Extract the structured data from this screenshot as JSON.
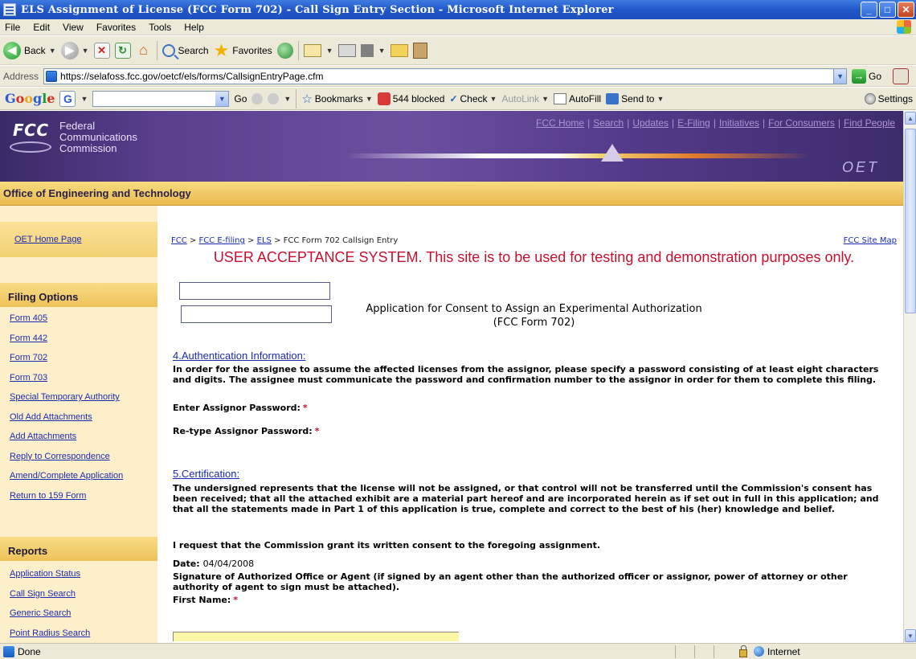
{
  "window": {
    "title": "ELS Assignment of License (FCC Form 702) - Call Sign Entry Section - Microsoft Internet Explorer"
  },
  "menu": [
    "File",
    "Edit",
    "View",
    "Favorites",
    "Tools",
    "Help"
  ],
  "toolbar": {
    "back": "Back",
    "search": "Search",
    "favorites": "Favorites"
  },
  "address": {
    "label": "Address",
    "url": "https://selafoss.fcc.gov/oetcf/els/forms/CallsignEntryPage.cfm",
    "go": "Go"
  },
  "google": {
    "logo": "Google",
    "go": "Go",
    "bookmarks": "Bookmarks",
    "blocked": "544 blocked",
    "check": "Check",
    "autolink": "AutoLink",
    "autofill": "AutoFill",
    "sendto": "Send to",
    "settings": "Settings"
  },
  "fcc": {
    "logo": "FCC",
    "name_lines": [
      "Federal",
      "Communications",
      "Commission"
    ],
    "links": [
      "FCC Home",
      "Search",
      "Updates",
      "E-Filing",
      "Initiatives",
      "For Consumers",
      "Find People"
    ],
    "oet_mark": "OET",
    "office_bar": "Office of Engineering and Technology"
  },
  "sidebar": {
    "home": "OET Home Page",
    "filing_title": "Filing Options",
    "filing_links": [
      "Form 405",
      "Form 442",
      "Form 702",
      "Form 703",
      "Special Temporary Authority",
      "Old Add Attachments",
      "Add Attachments",
      "Reply to Correspondence",
      "Amend/Complete Application",
      "Return to 159 Form"
    ],
    "reports_title": "Reports",
    "report_links": [
      "Application Status",
      "Call Sign Search",
      "Generic Search",
      "Point Radius Search"
    ]
  },
  "breadcrumb": {
    "fcc": "FCC",
    "efiling": "FCC E-filing",
    "els": "ELS",
    "current": "FCC Form 702 Callsign Entry",
    "sep": ">"
  },
  "sitemap": "FCC Site Map",
  "uat_notice": "USER ACCEPTANCE SYSTEM. This site is to be used for testing and demonstration purposes only.",
  "app_title": {
    "line1": "Application for Consent to Assign an Experimental Authorization",
    "line2": "(FCC Form 702)"
  },
  "auth": {
    "heading": "4.Authentication Information:",
    "text": "In order for the assignee to assume the affected licenses from the assignor, please specify a password consisting of at least eight characters and digits. The assignee must communicate the password and confirmation number to the assignor in order for them to complete this filing.",
    "password_label": "Enter Assignor Password:",
    "retype_label": "Re-type Assignor Password:",
    "required": "*"
  },
  "cert": {
    "heading": "5.Certification:",
    "text": "The undersigned represents that the license will not be assigned, or that control will not be transferred until the Commission's consent has been received; that all the attached exhibit are a material part hereof and are incorporated herein as if set out in full in this application; and that all the statements made in Part 1 of this application is true, complete and correct to the best of his (her) knowledge and belief.",
    "request": "I request that the Commission grant its written consent to the foregoing assignment.",
    "date_label": "Date:",
    "date_value": "04/04/2008",
    "signature": "Signature of Authorized Office or Agent (if signed by an agent other than the authorized officer or assignor, power of attorney or other authority of agent to sign must be attached).",
    "first_name": "First Name:"
  },
  "status": {
    "text": "Done",
    "zone": "Internet"
  }
}
